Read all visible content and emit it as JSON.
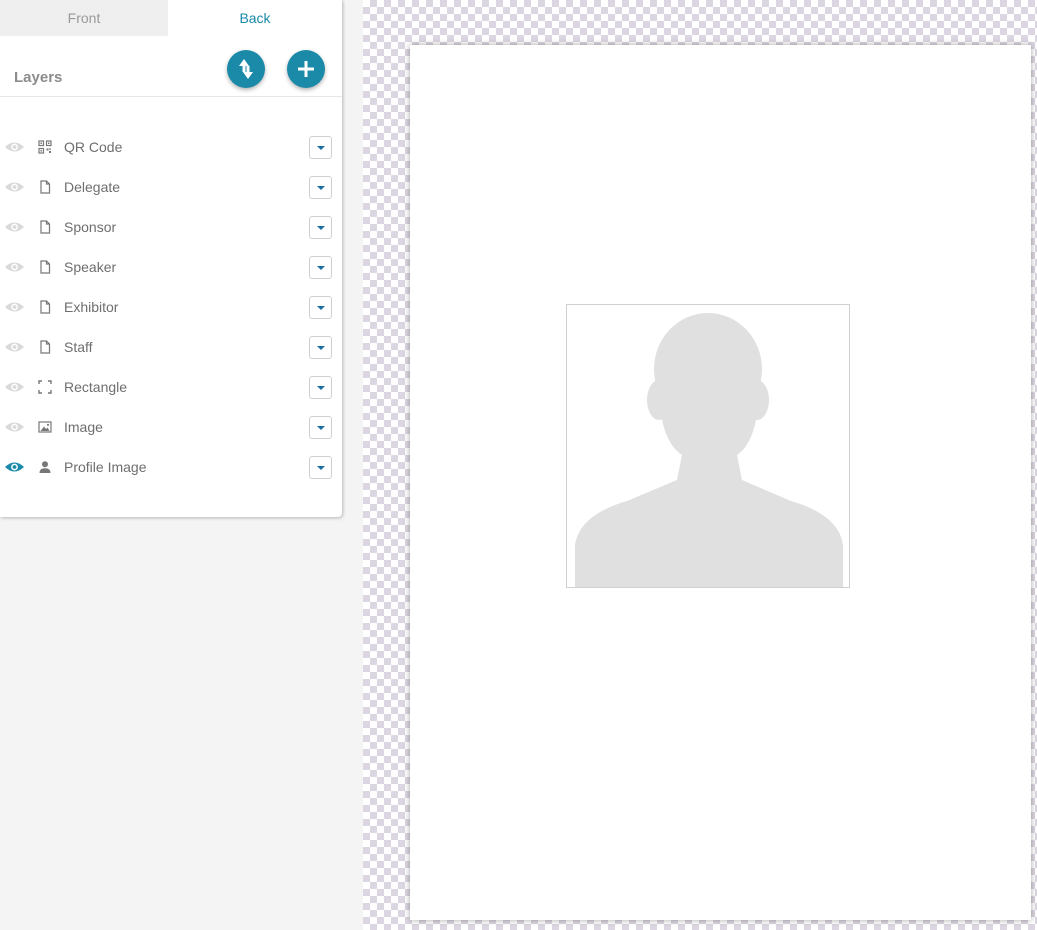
{
  "tabs": [
    {
      "label": "Front",
      "active": false
    },
    {
      "label": "Back",
      "active": true
    }
  ],
  "layers_title": "Layers",
  "layers": [
    {
      "label": "QR Code",
      "type_icon": "qr-code-icon",
      "visible": false
    },
    {
      "label": "Delegate",
      "type_icon": "text-file-icon",
      "visible": false
    },
    {
      "label": "Sponsor",
      "type_icon": "text-file-icon",
      "visible": false
    },
    {
      "label": "Speaker",
      "type_icon": "text-file-icon",
      "visible": false
    },
    {
      "label": "Exhibitor",
      "type_icon": "text-file-icon",
      "visible": false
    },
    {
      "label": "Staff",
      "type_icon": "text-file-icon",
      "visible": false
    },
    {
      "label": "Rectangle",
      "type_icon": "rectangle-icon",
      "visible": false
    },
    {
      "label": "Image",
      "type_icon": "image-icon",
      "visible": false
    },
    {
      "label": "Profile Image",
      "type_icon": "person-icon",
      "visible": true
    }
  ],
  "colors": {
    "accent": "#1a8aa8",
    "eye_inactive": "#d9d9d9",
    "eye_active": "#1a8aa8",
    "silhouette": "#e0e0e0"
  }
}
